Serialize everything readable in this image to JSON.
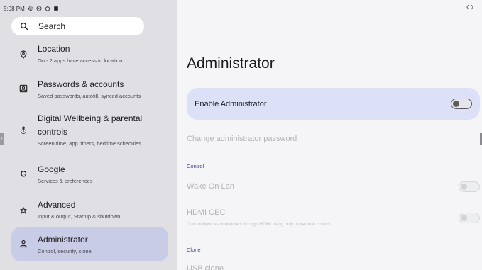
{
  "status_bar": {
    "time": "5:08 PM"
  },
  "search": {
    "placeholder": "Search"
  },
  "sidebar": {
    "items": [
      {
        "title": "Location",
        "subtitle": "On - 2 apps have access to location"
      },
      {
        "title": "Passwords & accounts",
        "subtitle": "Saved passwords, autofill, synced accounts"
      },
      {
        "title_line1": "Digital Wellbeing & parental",
        "title_line2": "controls",
        "subtitle": "Screen time, app timers, bedtime schedules"
      },
      {
        "title": "Google",
        "subtitle": "Services & preferences"
      },
      {
        "title": "Advanced",
        "subtitle": "Input & output, Startup & shutdown"
      },
      {
        "title": "Administrator",
        "subtitle": "Control, security, clone",
        "selected": true
      }
    ]
  },
  "main": {
    "title": "Administrator",
    "enable": {
      "label": "Enable Administrator",
      "enabled": false
    },
    "change_password": "Change administrator password",
    "sections": {
      "control": "Control",
      "clone": "Clone"
    },
    "wake_on_lan": {
      "label": "Wake On Lan",
      "enabled": false
    },
    "hdmi_cec": {
      "label": "HDMI CEC",
      "subtitle": "Control devices connected through HDMI using only on remote control",
      "enabled": false
    },
    "usb_clone": "USB clone"
  },
  "colors": {
    "selected_item_bg": "#c9cce6",
    "enable_card_bg": "#dde1f8",
    "section_label": "#3a4a8a"
  }
}
